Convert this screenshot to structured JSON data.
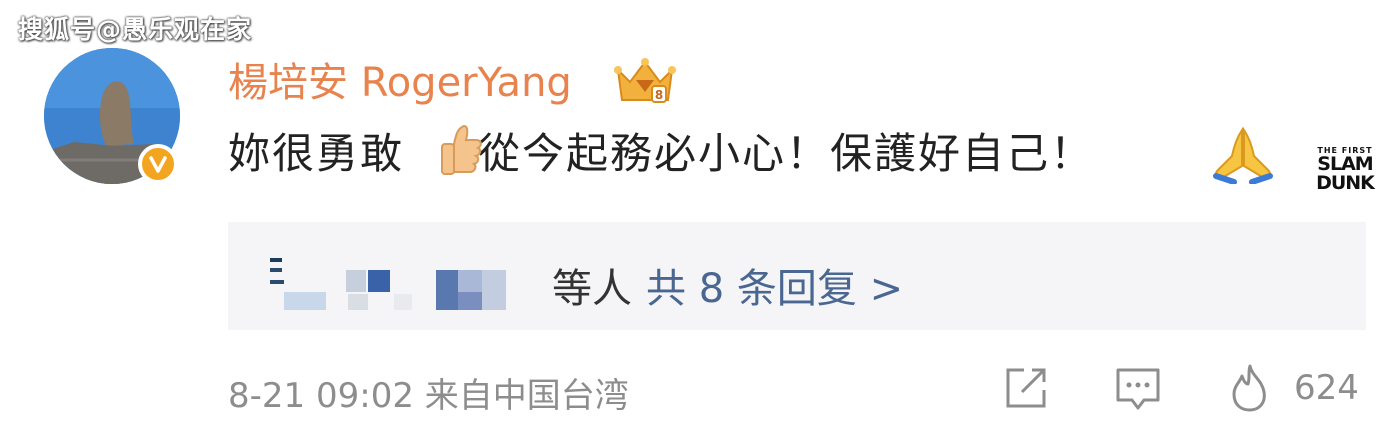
{
  "watermark": "搜狐号@愚乐观在家",
  "user": {
    "name": "楊培安 RogerYang",
    "avatar_icon": "avatar-image",
    "verified_icon": "verified-v-badge",
    "badge_icon": "crown-badge-icon"
  },
  "comment": {
    "text_part1": "妳很勇敢",
    "text_part2": "從今起務必小心！保護好自己！",
    "emoji1": "thumbs-up",
    "emoji2": "folded-hands",
    "sticker_top": "THE FIRST",
    "sticker_line1": "SLAM",
    "sticker_line2": "DUNK"
  },
  "replies": {
    "names_suffix": "等人",
    "count_text": "共 8 条回复 >"
  },
  "meta": {
    "time": "8-21 09:02",
    "source": "来自中国台湾",
    "likes": "624"
  },
  "colors": {
    "username": "#e8834e",
    "link": "#4a6791",
    "meta": "#8d8d8d",
    "reply_bg": "#f5f5f7",
    "verified": "#f3a51f"
  }
}
